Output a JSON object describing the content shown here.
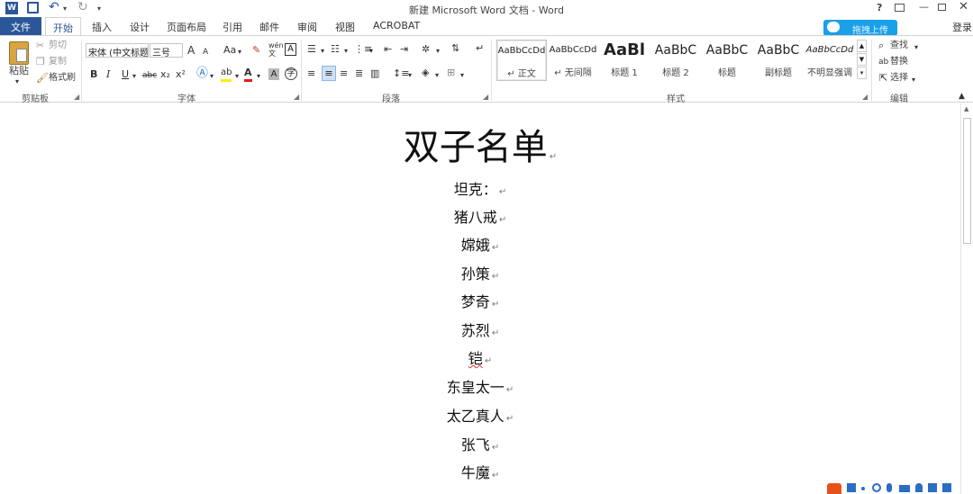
{
  "window": {
    "title": "新建 Microsoft Word 文档 - Word",
    "help": "?",
    "login": "登录",
    "upload_button": "拖拽上传"
  },
  "tabs": [
    "文件",
    "开始",
    "插入",
    "设计",
    "页面布局",
    "引用",
    "邮件",
    "审阅",
    "视图",
    "ACROBAT"
  ],
  "ribbon": {
    "clipboard": {
      "paste": "粘贴",
      "cut": "剪切",
      "copy": "复制",
      "format_painter": "格式刷",
      "label": "剪贴板"
    },
    "font": {
      "font_name": "宋体 (中文标题)",
      "font_size": "三号",
      "change_case": "Aa",
      "label": "字体",
      "bold": "B",
      "italic": "I",
      "underline": "U",
      "strike": "abc",
      "subscript": "x₂",
      "superscript": "x²",
      "grow": "A",
      "shrink": "A",
      "wen": "wén\n文",
      "border_a": "A"
    },
    "paragraph": {
      "label": "段落"
    },
    "styles": {
      "label": "样式",
      "items": [
        {
          "sample": "AaBbCcDd",
          "name": "↵ 正文"
        },
        {
          "sample": "AaBbCcDd",
          "name": "↵ 无间隔"
        },
        {
          "sample": "AaBl",
          "name": "标题 1"
        },
        {
          "sample": "AaBbC",
          "name": "标题 2"
        },
        {
          "sample": "AaBbC",
          "name": "标题"
        },
        {
          "sample": "AaBbC",
          "name": "副标题"
        },
        {
          "sample": "AaBbCcDd",
          "name": "不明显强调"
        }
      ]
    },
    "editing": {
      "find": "查找",
      "replace": "替换",
      "select": "选择",
      "label": "编辑"
    }
  },
  "document": {
    "title": "双子名单",
    "lines": [
      "坦克：",
      "猪八戒",
      "嫦娥",
      "孙策",
      "梦奇",
      "苏烈",
      "铠",
      "东皇太一",
      "太乙真人",
      "张飞",
      "牛魔"
    ]
  },
  "colors": {
    "accent": "#2b579a",
    "upload": "#1aa0e8"
  }
}
